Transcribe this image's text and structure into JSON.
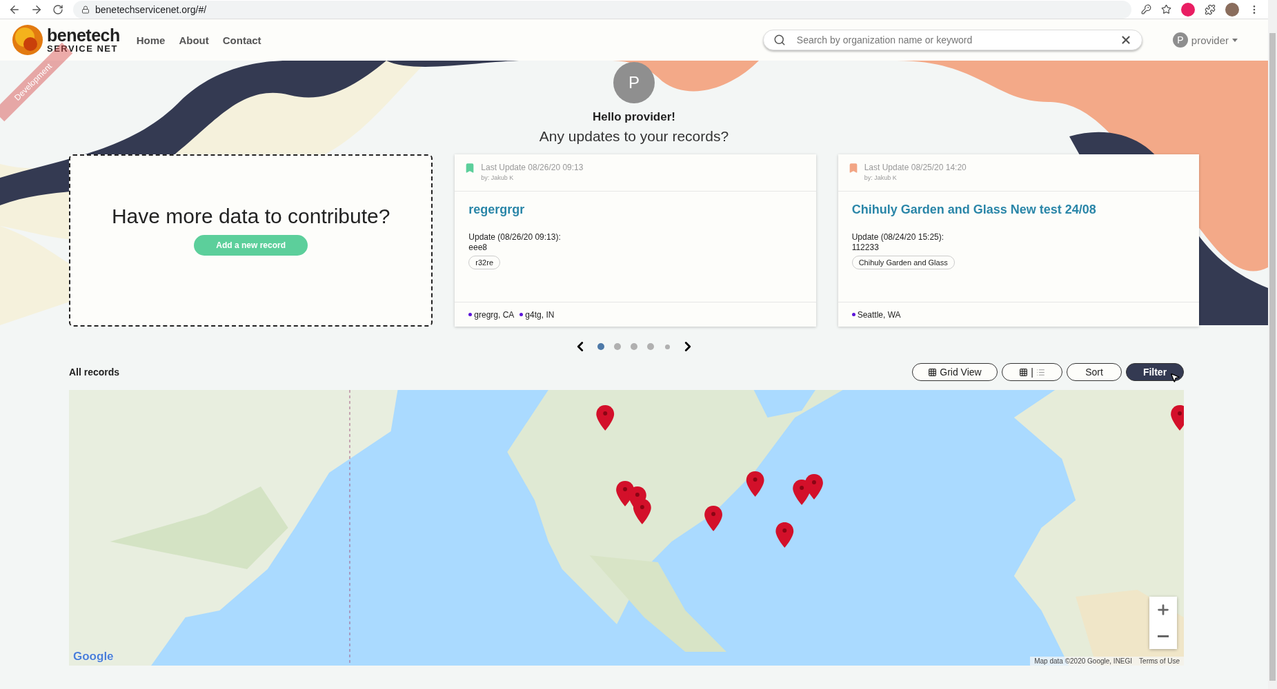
{
  "browser": {
    "url": "benetechservicenet.org/#/"
  },
  "navbar": {
    "brand_title": "benetech",
    "brand_subtitle": "SERVICE NET",
    "ribbon": "Development",
    "links": [
      "Home",
      "About",
      "Contact"
    ],
    "search": {
      "placeholder": "Search by organization name or keyword"
    },
    "user": {
      "initial": "P",
      "name": "provider"
    }
  },
  "hero": {
    "avatar": "P",
    "greeting": "Hello provider!",
    "question": "Any updates to your records?"
  },
  "contribute": {
    "title": "Have more data to contribute?",
    "button": "Add a new record"
  },
  "cards": [
    {
      "color": "#5ccf9b",
      "last_update": "Last Update 08/26/20 09:13",
      "by": "by: Jakub K",
      "title": "regergrgr",
      "update_label": "Update (08/26/20 09:13):",
      "update_value": "eee8",
      "tag": "r32re",
      "locations": [
        {
          "text": "gregrg, CA",
          "color": "#5b14d9"
        },
        {
          "text": "g4tg, IN",
          "color": "#5b14d9"
        }
      ]
    },
    {
      "color": "#f2a584",
      "last_update": "Last Update 08/25/20 14:20",
      "by": "by: Jakub K",
      "title": "Chihuly Garden and Glass New test 24/08",
      "update_label": "Update (08/24/20 15:25):",
      "update_value": "112233",
      "tag": "Chihuly Garden and Glass",
      "locations": [
        {
          "text": "Seattle, WA",
          "color": "#5b14d9"
        }
      ]
    }
  ],
  "carousel": {
    "dots": [
      {
        "selected": true,
        "kind": "full"
      },
      {
        "selected": false,
        "kind": "full"
      },
      {
        "selected": false,
        "kind": "full"
      },
      {
        "selected": false,
        "kind": "full"
      },
      {
        "selected": false,
        "kind": "small"
      }
    ]
  },
  "records": {
    "title": "All records",
    "buttons": [
      {
        "kind": "grid-view",
        "label": "Grid View",
        "selected": false
      },
      {
        "kind": "layout-toggle",
        "label": "|",
        "selected": false
      },
      {
        "kind": "plain",
        "label": "Sort",
        "selected": false
      },
      {
        "kind": "plain",
        "label": "Filter",
        "selected": true
      }
    ]
  },
  "map": {
    "logo": "Google",
    "attribution": "Map data ©2020 Google, INEGI",
    "terms": "Terms of Use"
  }
}
